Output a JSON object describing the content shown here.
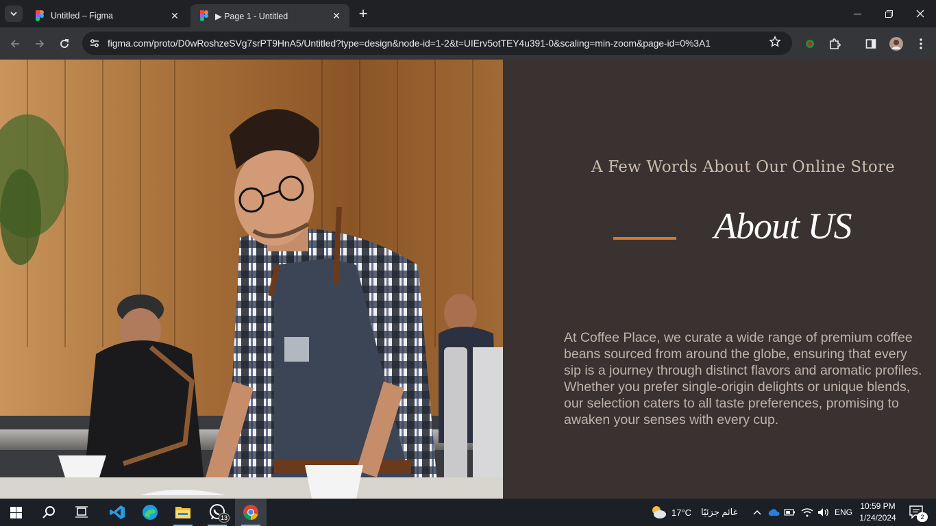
{
  "browser": {
    "tabs": [
      {
        "title": "Untitled – Figma",
        "active": false
      },
      {
        "title": "▶ Page 1 - Untitled",
        "active": true
      }
    ],
    "url": "figma.com/proto/D0wRoshzeSVg7srPT9HnA5/Untitled?type=design&node-id=1-2&t=UIErv5otTEY4u391-0&scaling=min-zoom&page-id=0%3A1",
    "close_symbol": "✕",
    "new_tab_symbol": "+",
    "window_controls": {
      "minimize": "—",
      "maximize": "❐",
      "close": "✕"
    }
  },
  "page": {
    "subtitle": "A  Few Words About Our Online Store",
    "heading": "About US",
    "body": "At Coffee Place, we curate a wide range of premium coffee beans sourced from around the globe, ensuring that every sip is a journey through distinct flavors and aromatic profiles. Whether you prefer single-origin delights or unique blends, our selection caters to all taste preferences, promising to awaken your senses with every cup.",
    "accent_color": "#d07c36",
    "panel_color": "#3a3131"
  },
  "taskbar": {
    "apps": [
      "windows-start",
      "search",
      "task-view",
      "vscode",
      "edge",
      "file-explorer",
      "whatsapp",
      "chrome"
    ],
    "whatsapp_badge": "13",
    "weather_temp": "17°C",
    "weather_desc": "غائم جزئيًا",
    "language": "ENG",
    "time": "10:59 PM",
    "date": "1/24/2024",
    "notification_count": "2"
  }
}
